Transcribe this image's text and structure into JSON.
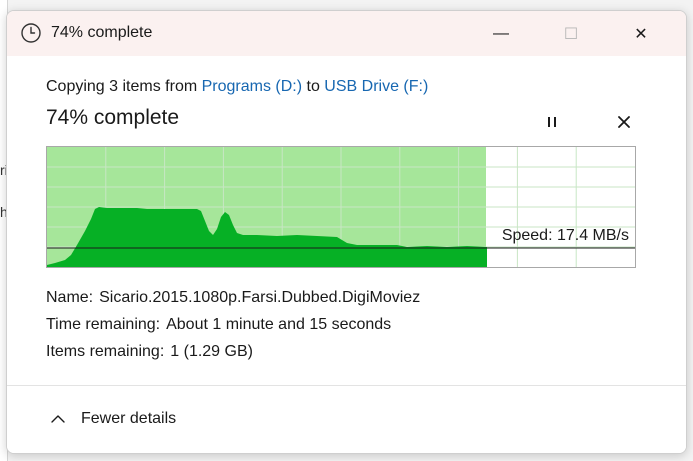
{
  "window": {
    "title": "74% complete",
    "controls": {
      "minimize": "—",
      "maximize": "☐",
      "close": "✕"
    }
  },
  "copy": {
    "prefix": "Copying 3 items from ",
    "source": "Programs (D:)",
    "middle": " to ",
    "destination": "USB Drive (F:)"
  },
  "progress": {
    "title": "74% complete",
    "fraction": 0.74,
    "speed_label": "Speed: 17.4 MB/s",
    "pause_icon": "pause-icon",
    "cancel_icon": "close-icon"
  },
  "details": {
    "name_label": "Name:",
    "name_value": "Sicario.2015.1080p.Farsi.Dubbed.DigiMoviez",
    "time_label": "Time remaining:",
    "time_value": "About 1 minute and 15 seconds",
    "items_label": "Items remaining:",
    "items_value": "1 (1.29 GB)"
  },
  "footer": {
    "toggle_label": "Fewer details"
  },
  "colors": {
    "progress_fill": "#a6e69a",
    "speed_area": "#06b025",
    "grid": "#c8e6c4",
    "link": "#1767b1"
  },
  "background": {
    "glyphs": [
      "ri",
      "h"
    ]
  }
}
